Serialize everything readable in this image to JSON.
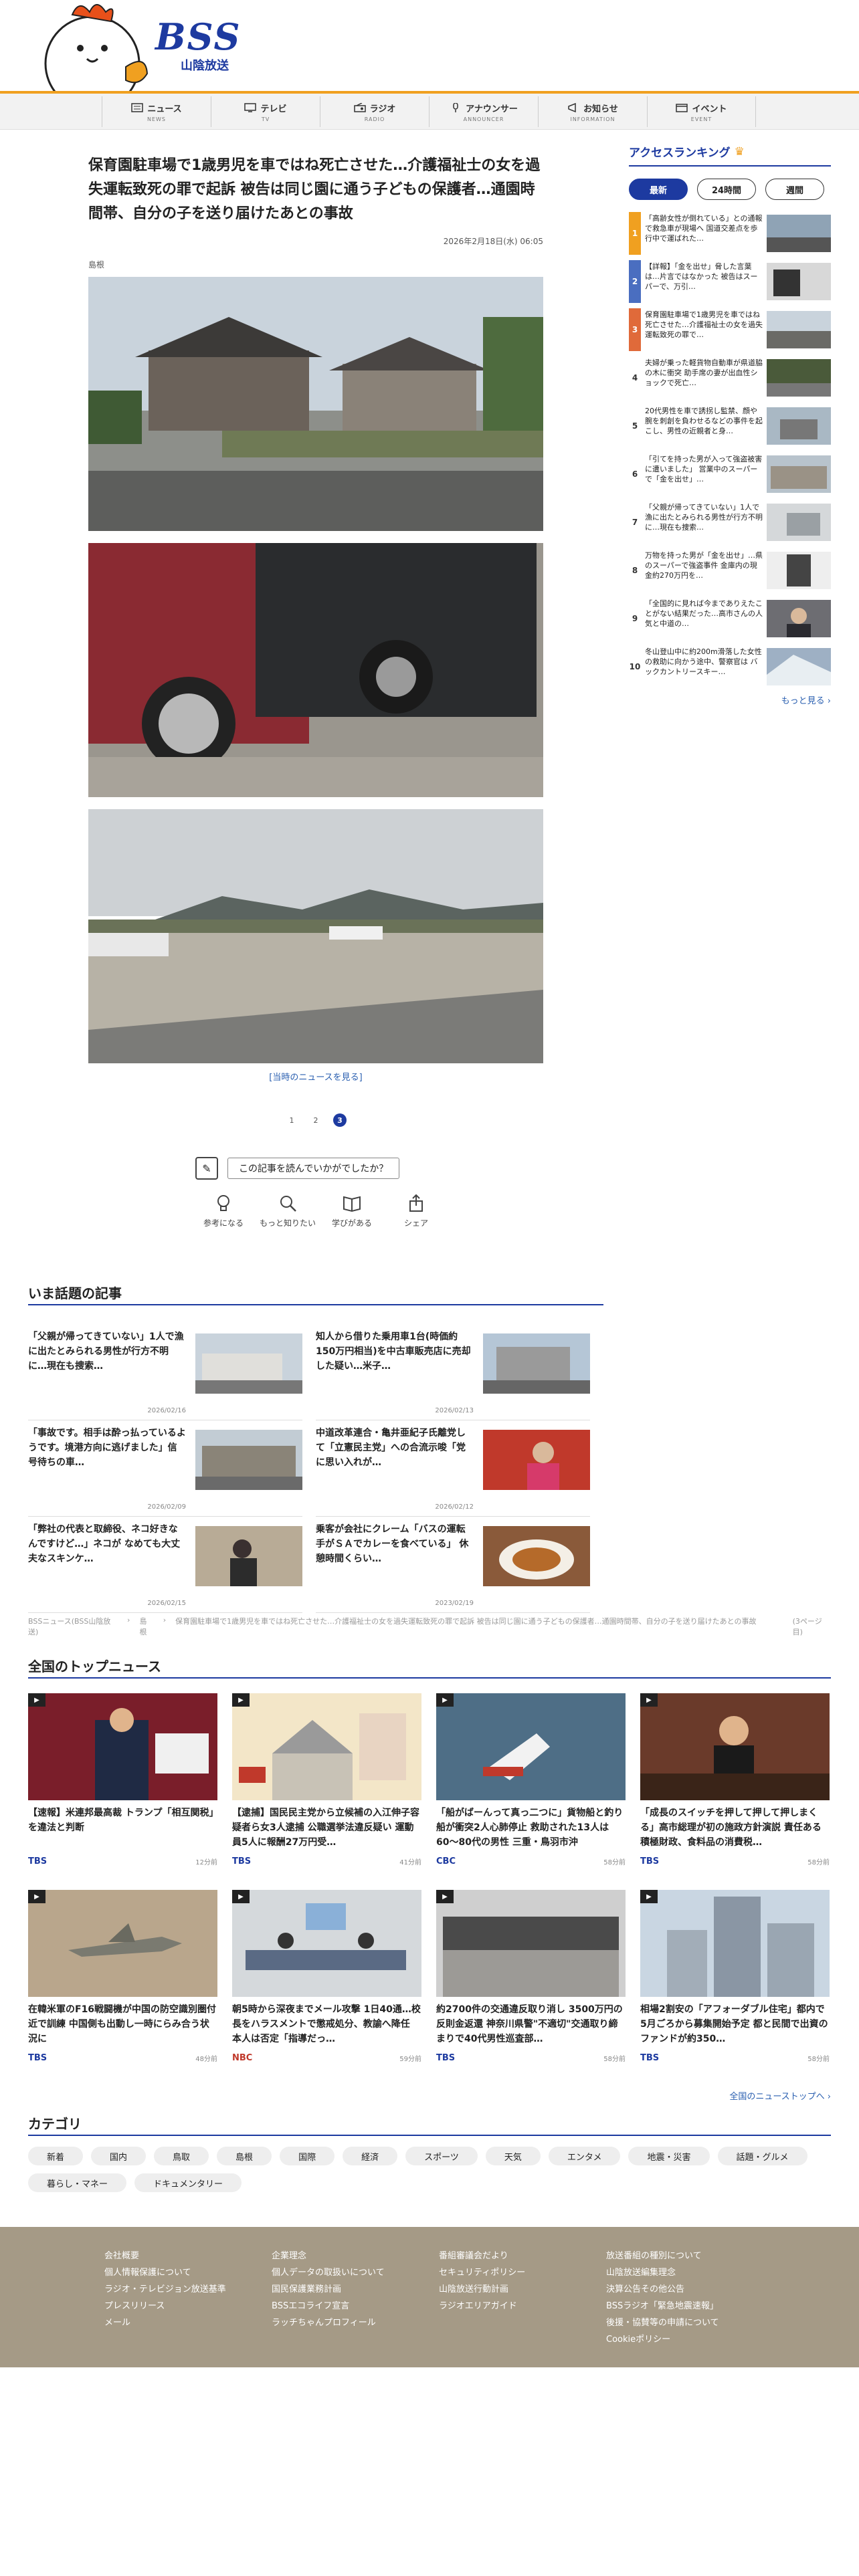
{
  "header": {
    "logo_text": "BSS",
    "logo_sub": "山陰放送",
    "colors": {
      "brand": "#1d3aa0",
      "accent": "#f0a020"
    }
  },
  "nav": [
    {
      "label": "ニュース",
      "en": "NEWS",
      "icon": "news-icon"
    },
    {
      "label": "テレビ",
      "en": "TV",
      "icon": "tv-icon"
    },
    {
      "label": "ラジオ",
      "en": "RADIO",
      "icon": "radio-icon"
    },
    {
      "label": "アナウンサー",
      "en": "ANNOUNCER",
      "icon": "microphone-icon"
    },
    {
      "label": "お知らせ",
      "en": "INFORMATION",
      "icon": "megaphone-icon"
    },
    {
      "label": "イベント",
      "en": "EVENT",
      "icon": "calendar-icon"
    }
  ],
  "article": {
    "title": "保育園駐車場で1歳男児を車ではね死亡させた…介護福祉士の女を過失運転致死の罪で起訴 被告は同じ園に通う子どもの保護者…通園時間帯、自分の子を送り届けたあとの事故",
    "date": "2026年2月18日(水) 06:05",
    "tag": "島根",
    "see_more": "[当時のニュースを見る]",
    "pages": [
      "1",
      "2",
      "3"
    ],
    "feedback_label": "この記事を読んでいかがでしたか？",
    "reactions": [
      {
        "label": "参考になる",
        "icon": "lightbulb-icon"
      },
      {
        "label": "もっと知りたい",
        "icon": "magnifier-icon"
      },
      {
        "label": "学びがある",
        "icon": "book-icon"
      },
      {
        "label": "シェア",
        "icon": "share-icon"
      }
    ]
  },
  "ranking": {
    "title": "アクセスランキング",
    "tabs": [
      "最新",
      "24時間",
      "週間"
    ],
    "items": [
      {
        "rank": "1",
        "text": "「高齢女性が倒れている」との通報で救急車が現場へ 国道交差点を歩行中で運ばれた…"
      },
      {
        "rank": "2",
        "text": "【詳報】「金を出せ」脅した言葉は…片言ではなかった 被告はスーパーで、万引…"
      },
      {
        "rank": "3",
        "text": "保育園駐車場で1歳男児を車ではね死亡させた…介護福祉士の女を過失運転致死の罪で…"
      },
      {
        "rank": "4",
        "text": "夫婦が乗った軽貨物自動車が県道脇の木に衝突 助手席の妻が出血性ショックで死亡…"
      },
      {
        "rank": "5",
        "text": "20代男性を車で誘拐し監禁、顔や腕を刺創を負わせるなどの事件を起こし、男性の近親者と身…"
      },
      {
        "rank": "6",
        "text": "「引てを持った男が入って強盗被害に遭いました」 営業中のスーパーで「金を出せ」…"
      },
      {
        "rank": "7",
        "text": "「父親が帰ってきていない」1人で漁に出たとみられる男性が行方不明に…現在も捜索…"
      },
      {
        "rank": "8",
        "text": "万物を持った男が「金を出せ」…県のスーパーで強盗事件 金庫内の現金約270万円を…"
      },
      {
        "rank": "9",
        "text": "「全国的に見れば今までありえたことがない結果だった…高市さんの人気と中道の…"
      },
      {
        "rank": "10",
        "text": "冬山登山中に約200m滑落した女性の救助に向かう途中、警察官は バックカントリースキー…"
      }
    ],
    "more": "もっと見る ›"
  },
  "topic": {
    "title": "いま話題の記事",
    "items": [
      {
        "title": "「父親が帰ってきていない」1人で漁に出たとみられる男性が行方不明に…現在も捜索…",
        "date": "2026/02/16"
      },
      {
        "title": "知人から借りた乗用車1台(時価約150万円相当)を中古車販売店に売却した疑い…米子…",
        "date": "2026/02/13"
      },
      {
        "title": "「事故です。相手は酔っ払っているようです。境港方向に逃げました」信号待ちの車…",
        "date": "2026/02/09"
      },
      {
        "title": "中道改革連合・亀井亜紀子氏離党して「立憲民主党」への合流示唆「党に思い入れが…",
        "date": "2026/02/12"
      },
      {
        "title": "「弊社の代表と取締役、ネコ好きなんですけど…」ネコが なめても大丈夫なスキンケ…",
        "date": "2026/02/15"
      },
      {
        "title": "乗客が会社にクレーム「バスの運転手がＳＡでカレーを食べている」 休憩時間くらい…",
        "date": "2023/02/19"
      }
    ]
  },
  "breadcrumb": [
    "BSSニュース(BSS山陰放送)",
    "島根",
    "保育園駐車場で1歳男児を車ではね死亡させた…介護福祉士の女を過失運転致死の罪で起訴 被告は同じ園に通う子どもの保護者…通園時間帯、自分の子を送り届けたあとの事故",
    "(3ページ目)"
  ],
  "national": {
    "title": "全国のトップニュース",
    "items": [
      {
        "title": "【速報】米連邦最高裁 トランプ「相互関税」を違法と判断",
        "source": "TBS",
        "time": "12分前"
      },
      {
        "title": "【逮捕】国民民主党から立候補の入江伸子容疑者ら女3人逮捕 公職選挙法違反疑い 運動員5人に報酬27万円受…",
        "source": "TBS",
        "time": "41分前"
      },
      {
        "title": "「船がばーんって真っ二つに」貨物船と釣り船が衝突2人心肺停止 救助された13人は60〜80代の男性 三重・鳥羽市沖",
        "source": "CBC",
        "time": "58分前"
      },
      {
        "title": "「成長のスイッチを押して押して押しまくる」高市総理が初の施政方針演説 責任ある積極財政、食料品の消費税…",
        "source": "TBS",
        "time": "58分前"
      },
      {
        "title": "在韓米軍のF16戦闘機が中国の防空識別圏付近で訓練 中国側も出動し一時にらみ合う状況に",
        "source": "TBS",
        "time": "48分前"
      },
      {
        "title": "朝5時から深夜までメール攻撃 1日40通…校長をハラスメントで懲戒処分、教諭へ降任 本人は否定「指導だっ…",
        "source": "NBC",
        "time": "59分前"
      },
      {
        "title": "約2700件の交通違反取り消し 3500万円の反則金返還 神奈川県警\"不適切\"交通取り締まりで40代男性巡査部…",
        "source": "TBS",
        "time": "58分前"
      },
      {
        "title": "相場2割安の「アフォーダブル住宅」都内で5月ごろから募集開始予定 都と民間で出資のファンドが約350…",
        "source": "TBS",
        "time": "58分前"
      }
    ],
    "more": "全国のニューストップへ ›"
  },
  "categories": {
    "title": "カテゴリ",
    "items": [
      "新着",
      "国内",
      "鳥取",
      "島根",
      "国際",
      "経済",
      "スポーツ",
      "天気",
      "エンタメ",
      "地震・災害",
      "話題・グルメ",
      "暮らし・マネー",
      "ドキュメンタリー"
    ]
  },
  "footer": {
    "columns": [
      [
        "会社概要",
        "個人情報保護について",
        "ラジオ・テレビジョン放送基準",
        "プレスリリース",
        "メール"
      ],
      [
        "企業理念",
        "個人データの取扱いについて",
        "国民保護業務計画",
        "BSSエコライフ宣言",
        "ラッチちゃんプロフィール"
      ],
      [
        "番組審議会だより",
        "セキュリティポリシー",
        "山陰放送行動計画",
        "ラジオエリアガイド"
      ],
      [
        "放送番組の種別について",
        "山陰放送編集理念",
        "決算公告その他公告",
        "BSSラジオ「緊急地震速報」",
        "後援・協賛等の申請について",
        "Cookieポリシー"
      ]
    ]
  }
}
